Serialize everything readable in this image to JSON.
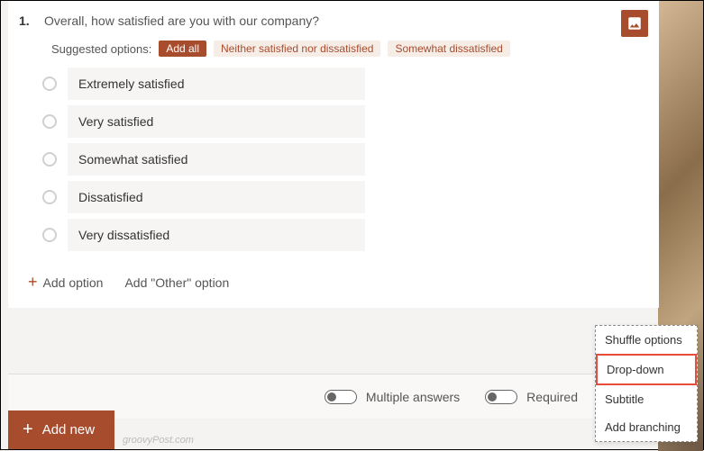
{
  "question": {
    "number": "1.",
    "text": "Overall, how satisfied are you with our company?"
  },
  "suggested": {
    "label": "Suggested options:",
    "add_all": "Add all",
    "chips": [
      "Neither satisfied nor dissatisfied",
      "Somewhat dissatisfied"
    ]
  },
  "options": [
    "Extremely satisfied",
    "Very satisfied",
    "Somewhat satisfied",
    "Dissatisfied",
    "Very dissatisfied"
  ],
  "add": {
    "option": "Add option",
    "other": "Add \"Other\" option"
  },
  "footer": {
    "multiple": "Multiple answers",
    "required": "Required"
  },
  "add_new": "Add new",
  "watermark": "groovyPost.com",
  "menu": {
    "shuffle": "Shuffle options",
    "dropdown": "Drop-down",
    "subtitle": "Subtitle",
    "branching": "Add branching"
  }
}
